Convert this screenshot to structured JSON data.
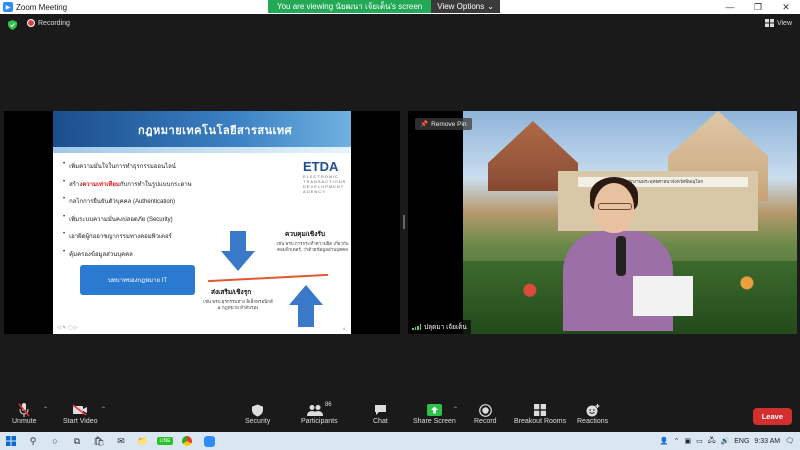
{
  "window": {
    "title": "Zoom Meeting",
    "minimize": "—",
    "restore": "❐",
    "close": "✕"
  },
  "banner": {
    "viewing_text": "You are viewing นัยฒนา เจ้ยเต็น's screen",
    "options_label": "View Options"
  },
  "status": {
    "recording_label": "Recording",
    "view_label": "View"
  },
  "slide": {
    "title": "กฎหมายเทคโนโลยีสารสนเทศ",
    "logo": "ETDA",
    "logo_sub": "ELECTRONIC TRANSACTIONS DEVELOPMENT AGENCY",
    "bullet_1": "เพิ่มความมั่นใจในการทำธุรกรรมออนไลน์",
    "bullet_2_pre": "สร้าง",
    "bullet_2_hl": "ความเท่าเทียม",
    "bullet_2_post": "กับการทำในรูปแบบกระดาษ",
    "bullet_3": "กลไกการยืนยันตัวบุคคล (Authentication)",
    "bullet_4": "เพิ่มระบบความมั่นคงปลอดภัย (Security)",
    "bullet_5": "เอาผิดผู้ก่ออาชญากรรมทางคอมพิวเตอร์",
    "bullet_6": "คุ้มครองข้อมูลส่วนบุคคล",
    "box_label": "บทบาทของกฎหมาย IT",
    "control_label": "ควบคุม/เชิงรับ",
    "control_sub": "เช่น พรบ.การกระทำความผิด เกี่ยวกับคอมพิวเตอร์, ว่าด้วยข้อมูลส่วนบุคคล",
    "promote_label": "ส่งเสริม/เชิงรุก",
    "promote_sub": "เช่น พรบ.ธุรกรรมทาง อิเล็กทรอนิกส์ & กฎหมาย ลำดับรอง",
    "slide_number": "4"
  },
  "camera": {
    "remove_pin": "Remove Pin",
    "participant_name": "ปลุดมา เจ้ยเต็น",
    "building_sign": "สำนักงานพระพุทธศาสนาจังหวัดพิษณุโลก"
  },
  "toolbar": {
    "unmute": "Unmute",
    "start_video": "Start Video",
    "security": "Security",
    "participants": "Participants",
    "participants_count": "86",
    "chat": "Chat",
    "share_screen": "Share Screen",
    "record": "Record",
    "breakout_rooms": "Breakout Rooms",
    "reactions": "Reactions",
    "leave": "Leave"
  },
  "taskbar": {
    "lang": "ENG",
    "time": "9:33 AM"
  },
  "colors": {
    "accent_green": "#23a855",
    "leave_red": "#d32f2f",
    "share_green": "#2ec14a"
  }
}
